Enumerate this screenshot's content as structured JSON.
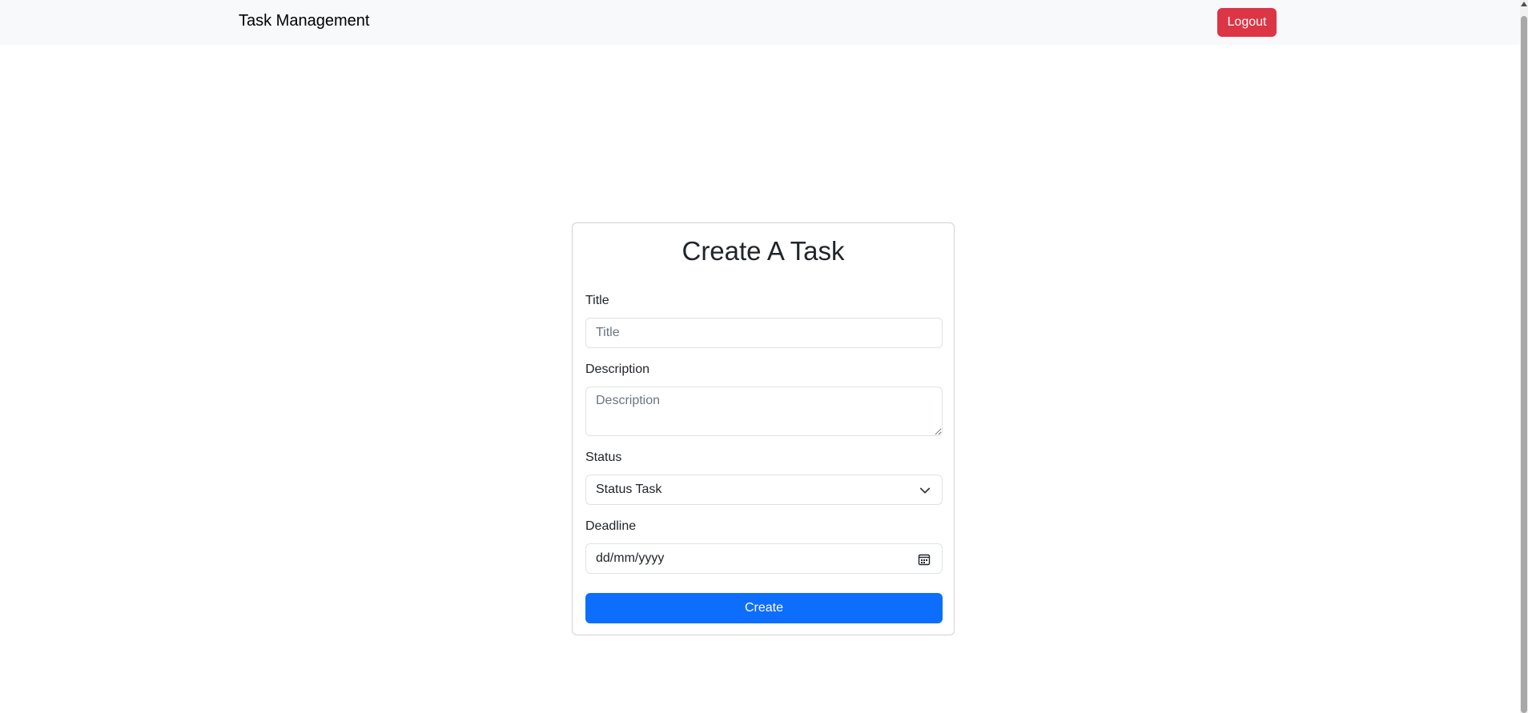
{
  "navbar": {
    "brand": "Task Management",
    "logout_label": "Logout"
  },
  "form": {
    "heading": "Create A Task",
    "title": {
      "label": "Title",
      "placeholder": "Title",
      "value": ""
    },
    "description": {
      "label": "Description",
      "placeholder": "Description",
      "value": ""
    },
    "status": {
      "label": "Status",
      "selected": "Status Task"
    },
    "deadline": {
      "label": "Deadline",
      "value": "dd/mm/yyyy"
    },
    "submit_label": "Create"
  },
  "colors": {
    "navbar_bg": "#f8f9fa",
    "logout_bg": "#dc3545",
    "primary": "#0d6efd"
  },
  "icons": {
    "status_dropdown": "chevron-down-icon",
    "deadline_picker": "calendar-icon"
  }
}
